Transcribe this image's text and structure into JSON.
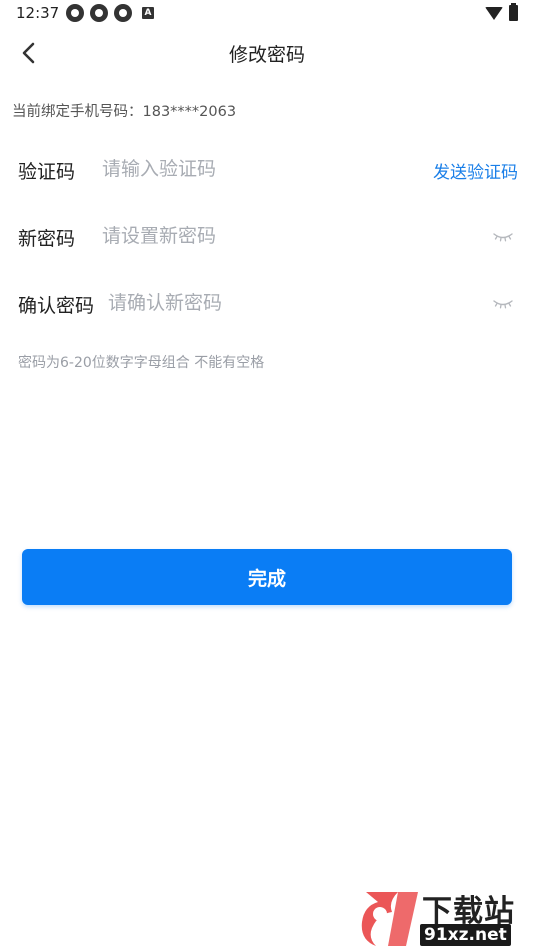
{
  "status_bar": {
    "time": "12:37",
    "left_icons": [
      "app-icon",
      "app-icon",
      "app-icon",
      "a-icon"
    ],
    "a_icon_label": "A",
    "right_icons": [
      "wifi-icon",
      "battery-icon"
    ]
  },
  "nav": {
    "title": "修改密码",
    "back_icon": "chevron-left-icon"
  },
  "binding": {
    "text": "当前绑定手机号码：183****2063"
  },
  "form": {
    "code": {
      "label": "验证码",
      "placeholder": "请输入验证码",
      "action": "发送验证码"
    },
    "new_password": {
      "label": "新密码",
      "placeholder": "请设置新密码",
      "toggle_icon": "eye-closed-icon"
    },
    "confirm_password": {
      "label": "确认密码",
      "placeholder": "请确认新密码",
      "toggle_icon": "eye-closed-icon"
    }
  },
  "hint": "密码为6-20位数字字母组合 不能有空格",
  "submit": {
    "label": "完成"
  },
  "watermark": {
    "title": "下载站",
    "domain": "91xz.net"
  },
  "colors": {
    "accent": "#0a7df5",
    "link": "#1a7fe8",
    "placeholder": "#a8acb3",
    "hint": "#9a9ea6",
    "watermark_logo": "#e8383a"
  }
}
